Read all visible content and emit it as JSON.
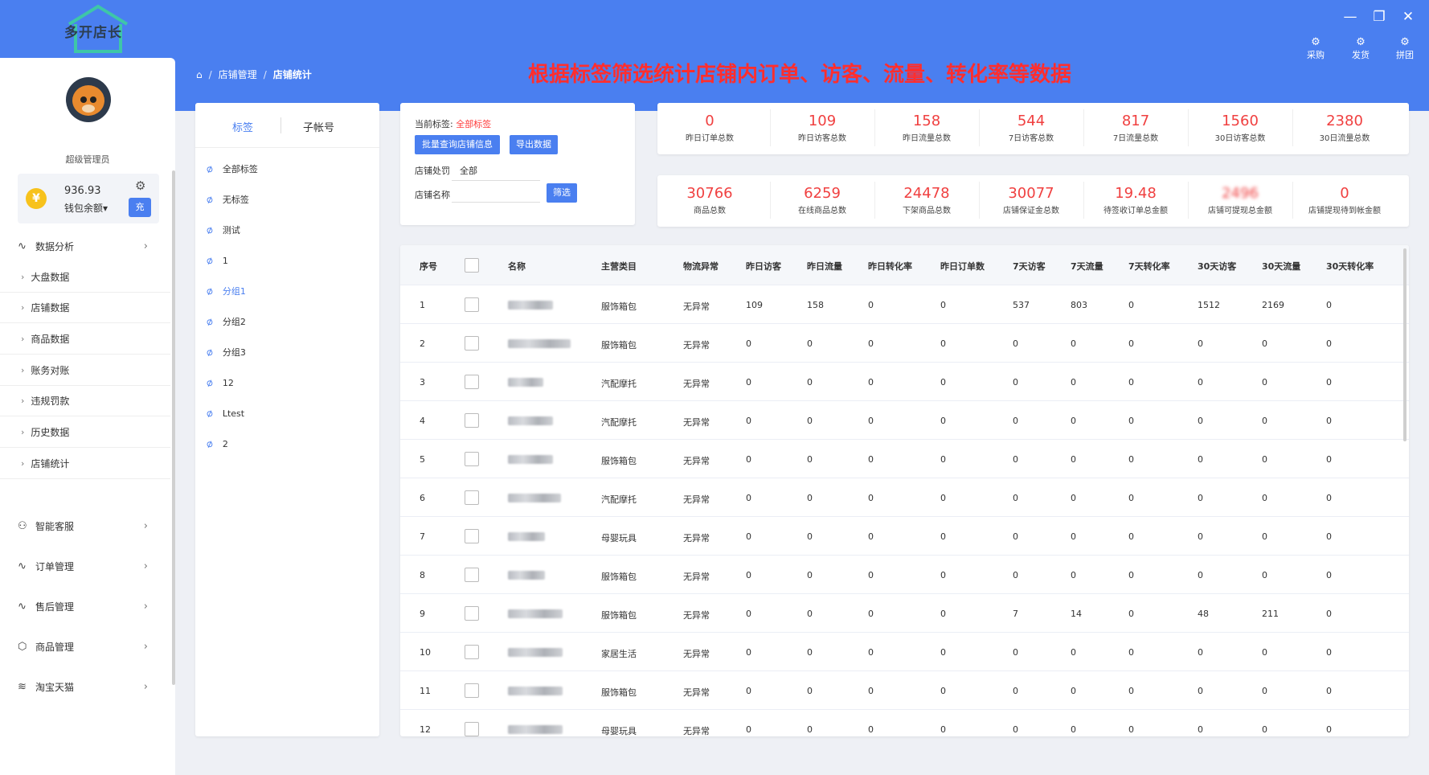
{
  "app": {
    "logo_text": "多开店长",
    "window_controls": [
      "minimize-icon",
      "restore-icon",
      "close-icon"
    ],
    "quick_actions": [
      {
        "icon": "gear-icon",
        "label": "采购"
      },
      {
        "icon": "gear-icon",
        "label": "发货"
      },
      {
        "icon": "gear-icon",
        "label": "拼团"
      }
    ]
  },
  "breadcrumb": {
    "items": [
      "店铺管理",
      "店铺统计"
    ]
  },
  "banner": "根据标签筛选统计店铺内订单、访客、流量、转化率等数据",
  "sidebar": {
    "role": "超级管理员",
    "wallet": {
      "amount": "936.93",
      "label": "钱包余额▾",
      "charge": "充"
    },
    "groups": [
      {
        "icon": "pulse-icon",
        "label": "数据分析"
      },
      {
        "icon": "users-icon",
        "label": "智能客服"
      },
      {
        "icon": "pulse-icon",
        "label": "订单管理"
      },
      {
        "icon": "pulse-icon",
        "label": "售后管理"
      },
      {
        "icon": "box-icon",
        "label": "商品管理"
      },
      {
        "icon": "layers-icon",
        "label": "淘宝天猫"
      }
    ],
    "sub_items": [
      "大盘数据",
      "店铺数据",
      "商品数据",
      "账务对账",
      "违规罚款",
      "历史数据",
      "店铺统计"
    ]
  },
  "tags": {
    "tabs": [
      "标签",
      "子帐号"
    ],
    "items": [
      "全部标签",
      "无标签",
      "测试",
      "1",
      "分组1",
      "分组2",
      "分组3",
      "12",
      "Ltest",
      "2"
    ],
    "active_index": 4
  },
  "filter": {
    "current_tag_label": "当前标签:",
    "current_tag_value": "全部标签",
    "btn_batch": "批量查询店铺信息",
    "btn_export": "导出数据",
    "penalty_label": "店铺处罚",
    "penalty_value": "全部",
    "name_label": "店铺名称",
    "name_placeholder": "",
    "btn_filter": "筛选"
  },
  "stats_row1": [
    {
      "value": "0",
      "label": "昨日订单总数"
    },
    {
      "value": "109",
      "label": "昨日访客总数"
    },
    {
      "value": "158",
      "label": "昨日流量总数"
    },
    {
      "value": "544",
      "label": "7日访客总数"
    },
    {
      "value": "817",
      "label": "7日流量总数"
    },
    {
      "value": "1560",
      "label": "30日访客总数"
    },
    {
      "value": "2380",
      "label": "30日流量总数"
    }
  ],
  "stats_row2": [
    {
      "value": "30766",
      "label": "商品总数"
    },
    {
      "value": "6259",
      "label": "在线商品总数"
    },
    {
      "value": "24478",
      "label": "下架商品总数"
    },
    {
      "value": "30077",
      "label": "店铺保证金总数"
    },
    {
      "value": "19.48",
      "label": "待签收订单总金额"
    },
    {
      "value": "2496",
      "label": "店铺可提现总金额"
    },
    {
      "value": "0",
      "label": "店铺提现待到帐金额"
    }
  ],
  "colors": {
    "accent": "#4a7ff0",
    "stat_value": "#f04040",
    "banner": "#ff2e2e"
  },
  "table": {
    "headers": [
      "序号",
      "",
      "名称",
      "主营类目",
      "物流异常",
      "昨日访客",
      "昨日流量",
      "昨日转化率",
      "昨日订单数",
      "7天访客",
      "7天流量",
      "7天转化率",
      "30天访客",
      "30天流量",
      "30天转化率"
    ],
    "rows": [
      {
        "no": "1",
        "category": "服饰箱包",
        "logistics": "无异常",
        "vals": [
          "109",
          "158",
          "0",
          "0",
          "537",
          "803",
          "0",
          "1512",
          "2169",
          "0"
        ]
      },
      {
        "no": "2",
        "category": "服饰箱包",
        "logistics": "无异常",
        "vals": [
          "0",
          "0",
          "0",
          "0",
          "0",
          "0",
          "0",
          "0",
          "0",
          "0"
        ]
      },
      {
        "no": "3",
        "category": "汽配摩托",
        "logistics": "无异常",
        "vals": [
          "0",
          "0",
          "0",
          "0",
          "0",
          "0",
          "0",
          "0",
          "0",
          "0"
        ]
      },
      {
        "no": "4",
        "category": "汽配摩托",
        "logistics": "无异常",
        "vals": [
          "0",
          "0",
          "0",
          "0",
          "0",
          "0",
          "0",
          "0",
          "0",
          "0"
        ]
      },
      {
        "no": "5",
        "category": "服饰箱包",
        "logistics": "无异常",
        "vals": [
          "0",
          "0",
          "0",
          "0",
          "0",
          "0",
          "0",
          "0",
          "0",
          "0"
        ]
      },
      {
        "no": "6",
        "category": "汽配摩托",
        "logistics": "无异常",
        "vals": [
          "0",
          "0",
          "0",
          "0",
          "0",
          "0",
          "0",
          "0",
          "0",
          "0"
        ]
      },
      {
        "no": "7",
        "category": "母婴玩具",
        "logistics": "无异常",
        "vals": [
          "0",
          "0",
          "0",
          "0",
          "0",
          "0",
          "0",
          "0",
          "0",
          "0"
        ]
      },
      {
        "no": "8",
        "category": "服饰箱包",
        "logistics": "无异常",
        "vals": [
          "0",
          "0",
          "0",
          "0",
          "0",
          "0",
          "0",
          "0",
          "0",
          "0"
        ]
      },
      {
        "no": "9",
        "category": "服饰箱包",
        "logistics": "无异常",
        "vals": [
          "0",
          "0",
          "0",
          "0",
          "7",
          "14",
          "0",
          "48",
          "211",
          "0"
        ]
      },
      {
        "no": "10",
        "category": "家居生活",
        "logistics": "无异常",
        "vals": [
          "0",
          "0",
          "0",
          "0",
          "0",
          "0",
          "0",
          "0",
          "0",
          "0"
        ]
      },
      {
        "no": "11",
        "category": "服饰箱包",
        "logistics": "无异常",
        "vals": [
          "0",
          "0",
          "0",
          "0",
          "0",
          "0",
          "0",
          "0",
          "0",
          "0"
        ]
      },
      {
        "no": "12",
        "category": "母婴玩具",
        "logistics": "无异常",
        "vals": [
          "0",
          "0",
          "0",
          "0",
          "0",
          "0",
          "0",
          "0",
          "0",
          "0"
        ]
      }
    ]
  }
}
